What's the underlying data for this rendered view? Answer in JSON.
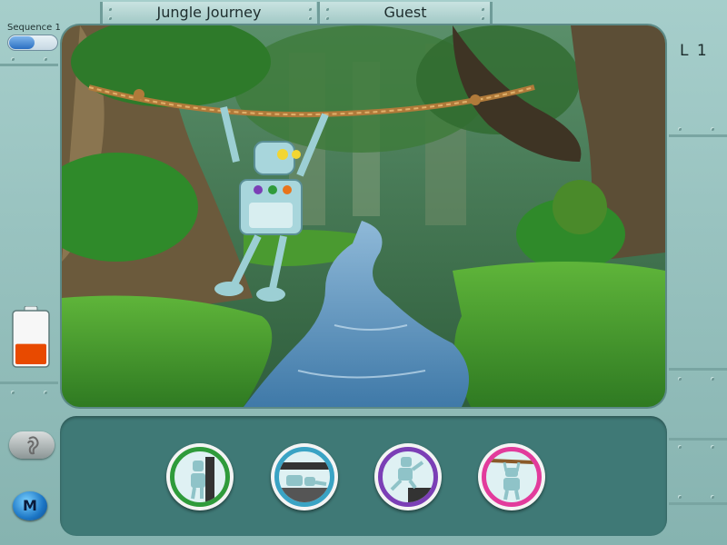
{
  "header": {
    "game_title": "Jungle Journey",
    "user_name": "Guest"
  },
  "sequence": {
    "label": "Sequence 1"
  },
  "level": {
    "label": "L 1"
  },
  "battery": {
    "charge_fraction": 0.4,
    "fill_color": "#e84a00"
  },
  "colors": {
    "frame": "#a6cecb",
    "panel": "#3f7976",
    "choice1_ring": "#2f9b3b",
    "choice2_ring": "#3aa3c4",
    "choice3_ring": "#7b3fb6",
    "choice4_ring": "#e23b9c"
  },
  "choices": [
    {
      "icon": "robot-standing-wall-icon"
    },
    {
      "icon": "robot-lying-tunnel-icon"
    },
    {
      "icon": "robot-jumping-step-icon"
    },
    {
      "icon": "robot-hanging-rope-icon"
    }
  ],
  "buttons": {
    "ear_icon": "ear-icon",
    "menu_label": "M"
  }
}
